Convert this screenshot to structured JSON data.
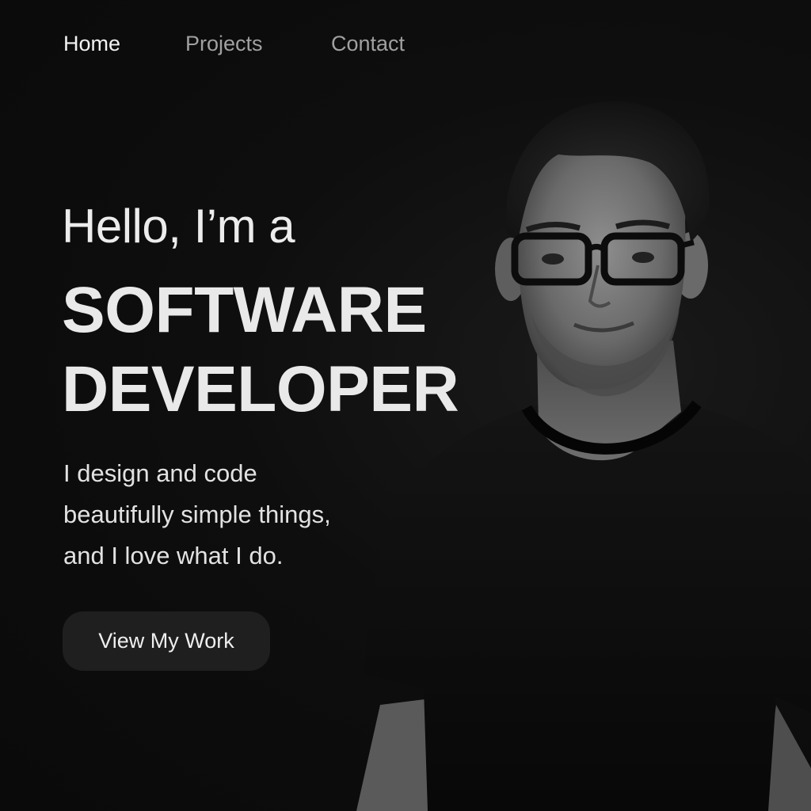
{
  "nav": {
    "items": [
      {
        "label": "Home",
        "active": true
      },
      {
        "label": "Projects",
        "active": false
      },
      {
        "label": "Contact",
        "active": false
      }
    ]
  },
  "hero": {
    "greeting": "Hello, I’m a",
    "title_line1": "SOFTWARE",
    "title_line2": "DEVELOPER",
    "tagline_line1": "I design and code",
    "tagline_line2": "beautifully simple things,",
    "tagline_line3": "and I love what I do.",
    "cta_label": "View My Work"
  },
  "colors": {
    "background": "#0b0b0b",
    "text_primary": "#ececec",
    "nav_inactive": "#a0a0a0",
    "button_bg": "#1f1f1f"
  }
}
